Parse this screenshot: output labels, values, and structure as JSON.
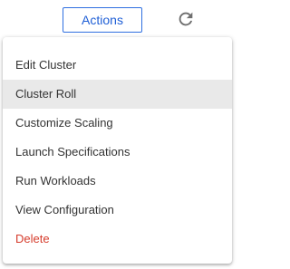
{
  "toolbar": {
    "actions_label": "Actions",
    "refresh_icon": "refresh-icon"
  },
  "menu": {
    "items": [
      {
        "label": "Edit Cluster"
      },
      {
        "label": "Cluster Roll",
        "state": "hovered"
      },
      {
        "label": "Customize Scaling"
      },
      {
        "label": "Launch Specifications"
      },
      {
        "label": "Run Workloads"
      },
      {
        "label": "View Configuration"
      },
      {
        "label": "Delete",
        "color": "#d63c2c"
      }
    ]
  },
  "colors": {
    "accent": "#1f5fd6",
    "danger": "#d63c2c",
    "hover_background": "#e9e9e9"
  }
}
